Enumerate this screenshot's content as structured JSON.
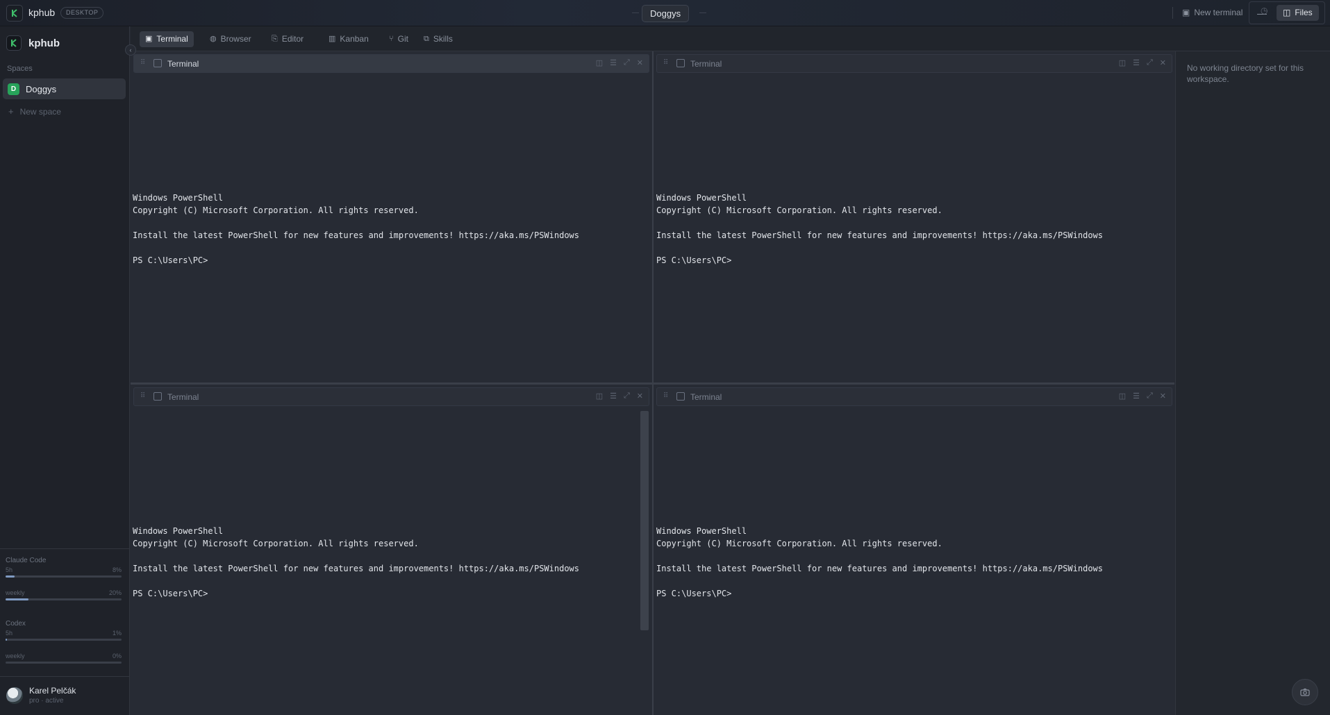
{
  "window": {
    "app_name": "kphub",
    "badge": "DESKTOP",
    "workspace_title": "Doggys",
    "controls": {
      "minimize": "—",
      "maximize": "☐",
      "close": "✕"
    }
  },
  "sidebar": {
    "title": "kphub",
    "section_label": "Spaces",
    "spaces": [
      {
        "initial": "D",
        "name": "Doggys",
        "color": "#27a35a"
      }
    ],
    "new_space_label": "New space",
    "usage": {
      "claude": {
        "label": "Claude Code",
        "rows": [
          {
            "label": "5h",
            "percent_text": "8%",
            "value": 8
          },
          {
            "label": "weekly",
            "percent_text": "20%",
            "value": 20
          }
        ]
      },
      "codex": {
        "label": "Codex",
        "rows": [
          {
            "label": "5h",
            "percent_text": "1%",
            "value": 1
          },
          {
            "label": "weekly",
            "percent_text": "0%",
            "value": 0
          }
        ]
      }
    },
    "user": {
      "name": "Karel Pelčák",
      "status": "pro · active"
    }
  },
  "toolbar": {
    "tabs": [
      {
        "label": "Terminal",
        "icon": "terminal-icon",
        "active": true
      },
      {
        "label": "Browser",
        "icon": "globe-icon",
        "active": false
      },
      {
        "label": "Editor",
        "icon": "file-code-icon",
        "active": false
      },
      {
        "label": "Kanban",
        "icon": "kanban-icon",
        "active": false
      },
      {
        "label": "Git",
        "icon": "git-branch-icon",
        "active": false
      },
      {
        "label": "Skills",
        "icon": "puzzle-icon",
        "active": false
      }
    ],
    "new_terminal_label": "New terminal",
    "files_label": "Files"
  },
  "panes": [
    {
      "title": "Terminal",
      "focused": true
    },
    {
      "title": "Terminal",
      "focused": false
    },
    {
      "title": "Terminal",
      "focused": false
    },
    {
      "title": "Terminal",
      "focused": false
    }
  ],
  "terminal_output": {
    "line1": "Windows PowerShell",
    "line2": "Copyright (C) Microsoft Corporation. All rights reserved.",
    "line3": "Install the latest PowerShell for new features and improvements! https://aka.ms/PSWindows",
    "prompt": "PS C:\\Users\\PC>"
  },
  "files_panel": {
    "message": "No working directory set for this workspace."
  },
  "colors": {
    "accent_green": "#27a35a",
    "usage_bar": "#7f9ac2"
  }
}
